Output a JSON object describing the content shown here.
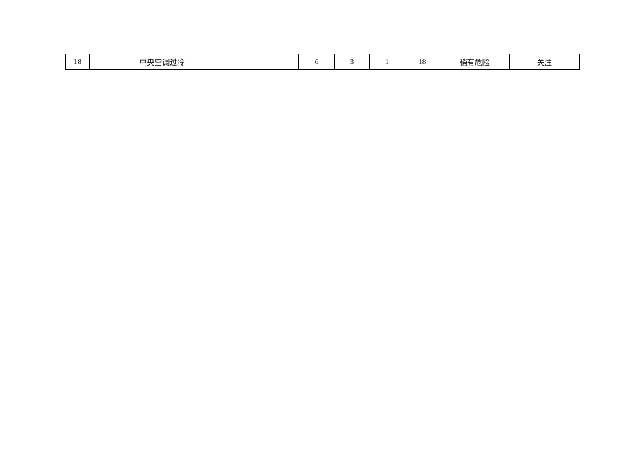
{
  "table": {
    "rows": [
      {
        "num": "18",
        "col2": "",
        "description": "中央空调过冷",
        "val1": "6",
        "val2": "3",
        "val3": "1",
        "val4": "18",
        "risk": "稍有危险",
        "action": "关注"
      }
    ]
  }
}
